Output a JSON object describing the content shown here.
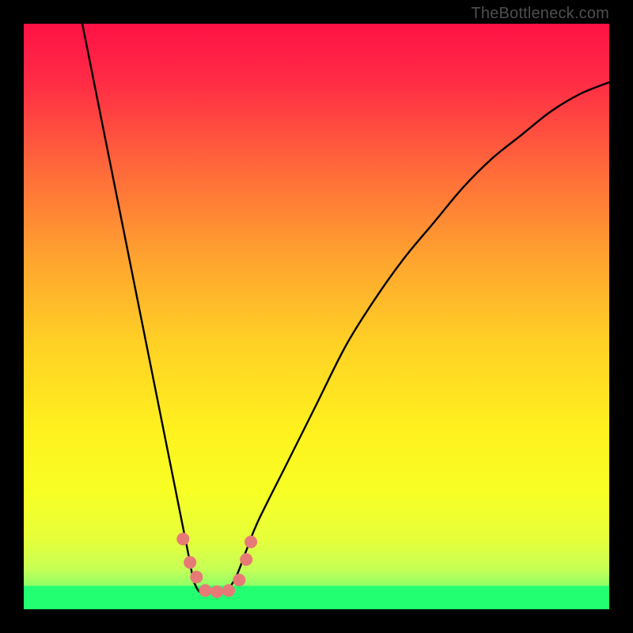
{
  "watermark": "TheBottleneck.com",
  "chart_data": {
    "type": "line",
    "title": "",
    "xlabel": "",
    "ylabel": "",
    "xlim": [
      0,
      100
    ],
    "ylim": [
      0,
      100
    ],
    "grid": false,
    "series": [
      {
        "name": "curve",
        "x": [
          10,
          12,
          14,
          16,
          18,
          20,
          22,
          24,
          26,
          28,
          29,
          30,
          31,
          34,
          36,
          38,
          40,
          45,
          50,
          55,
          60,
          65,
          70,
          75,
          80,
          85,
          90,
          95,
          100
        ],
        "y": [
          100,
          90,
          80,
          70,
          60,
          50,
          40,
          30,
          20,
          10,
          5,
          3,
          3,
          3,
          5,
          10,
          15,
          25,
          35,
          45,
          53,
          60,
          66,
          72,
          77,
          81,
          85,
          88,
          90
        ]
      }
    ],
    "green_band": {
      "y0": 0,
      "y1": 4,
      "color": "#22ff70"
    },
    "markers": {
      "name": "dots",
      "color": "#e77a76",
      "points": [
        {
          "x": 27.2,
          "y": 12.0
        },
        {
          "x": 28.4,
          "y": 8.0
        },
        {
          "x": 29.5,
          "y": 5.5
        },
        {
          "x": 31.0,
          "y": 3.2
        },
        {
          "x": 33.0,
          "y": 3.0
        },
        {
          "x": 35.0,
          "y": 3.2
        },
        {
          "x": 36.8,
          "y": 5.0
        },
        {
          "x": 38.0,
          "y": 8.5
        },
        {
          "x": 38.8,
          "y": 11.5
        }
      ]
    }
  }
}
